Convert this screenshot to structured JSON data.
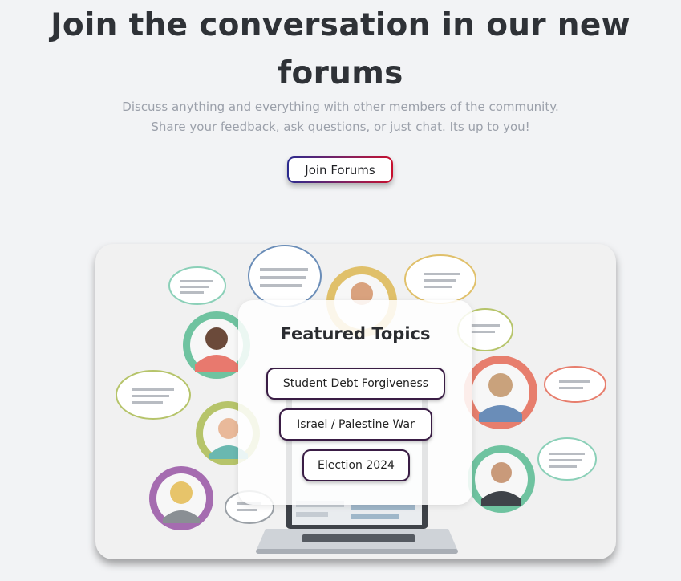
{
  "hero": {
    "title": "Join the conversation in our new forums",
    "subtitle_line1": "Discuss anything and everything with other members of the community.",
    "subtitle_line2": "Share your feedback, ask questions, or just chat. Its up to you!",
    "join_button": "Join Forums"
  },
  "featured": {
    "title": "Featured Topics",
    "topics": [
      "Student Debt Forgiveness",
      "Israel / Palestine War",
      "Election 2024"
    ]
  },
  "illustration": {
    "icon": "people-chat-bubbles-illustration",
    "bubble_colors": [
      "#6fc3a0",
      "#b6c46a",
      "#a56cb0",
      "#e0c06a",
      "#e77e6d",
      "#6a8db8",
      "#8bd0b8"
    ]
  },
  "colors": {
    "background": "#f2f3f5",
    "title": "#2f3237",
    "subtitle": "#9ba0aa",
    "topic_border": "#3a1d45"
  }
}
